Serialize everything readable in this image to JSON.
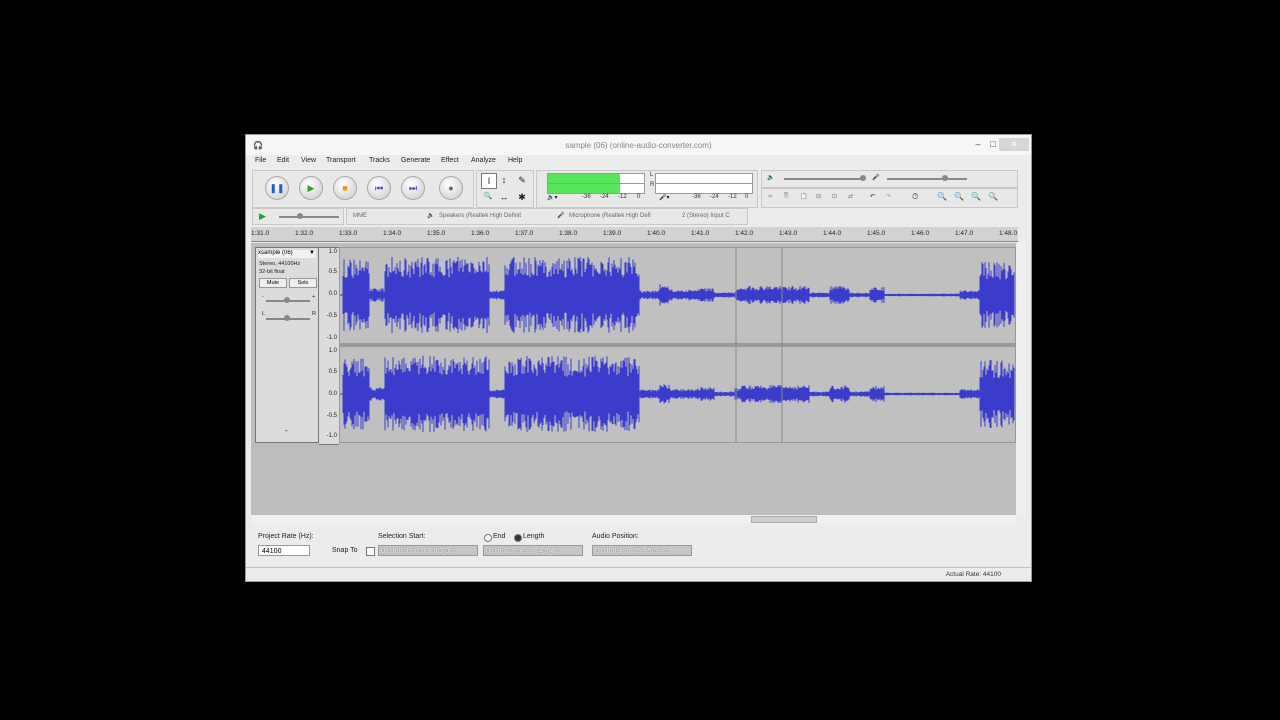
{
  "window": {
    "title": "sample (06) (online-audio-converter.com)",
    "minimize": "–",
    "maximize": "□",
    "close": "✕"
  },
  "menu": [
    "File",
    "Edit",
    "View",
    "Transport",
    "Tracks",
    "Generate",
    "Effect",
    "Analyze",
    "Help"
  ],
  "transport": {
    "pause": "❚❚",
    "play": "▶",
    "stop": "■",
    "skip_start": "⏮",
    "skip_end": "⏭",
    "record": "●"
  },
  "tools": {
    "selection": "I",
    "envelope": "↕",
    "draw": "✎",
    "zoom": "🔍",
    "timeshift": "↔",
    "multi": "✱"
  },
  "meters": {
    "playback_level": 0.75,
    "record_scale": [
      "-36",
      "-24",
      "-12",
      "0"
    ],
    "playback_scale": [
      "-36",
      "-24",
      "-12",
      "0"
    ],
    "channel_left": "L",
    "channel_right": "R"
  },
  "device_toolbar": {
    "host": "MME",
    "output_device": "Speakers (Realtek High Definit",
    "input_device": "Microphone (Realtek High Defi",
    "channels": "2 (Stereo) Input C"
  },
  "ruler_ticks": [
    "1:31.0",
    "1:32.0",
    "1:33.0",
    "1:34.0",
    "1:35.0",
    "1:36.0",
    "1:37.0",
    "1:38.0",
    "1:39.0",
    "1:40.0",
    "1:41.0",
    "1:42.0",
    "1:43.0",
    "1:44.0",
    "1:45.0",
    "1:46.0",
    "1:47.0",
    "1:48.0"
  ],
  "track": {
    "name": "sample (06)",
    "close": "x",
    "menu_arrow": "▼",
    "info_line1": "Stereo, 44100Hz",
    "info_line2": "32-bit float",
    "mute": "Mute",
    "solo": "Solo",
    "gain_minus": "-",
    "gain_plus": "+",
    "pan_l": "L",
    "pan_r": "R",
    "collapse": "⌃",
    "scale": [
      "1.0",
      "0.5",
      "0.0",
      "-0.5",
      "-1.0"
    ]
  },
  "selection_bar": {
    "project_rate_label": "Project Rate (Hz):",
    "project_rate": "44100",
    "snap_to_label": "Snap To",
    "selection_start_label": "Selection Start:",
    "end_label": "End",
    "length_label": "Length",
    "audio_position_label": "Audio Position:",
    "selection_start": "0 0 h 0 0 m 0 0 . 0 0 0 s",
    "length_value": "0 0 h 0 2 m 3 0 . 4 0 4 s",
    "audio_position": "0 0 h 0 1 m 2 5 . 5 6 8 s"
  },
  "status": {
    "actual_rate": "Actual Rate: 44100"
  },
  "colors": {
    "waveform": "#3c3ccc",
    "meter_green": "#57e65a",
    "track_bg": "#c0c0c0"
  }
}
